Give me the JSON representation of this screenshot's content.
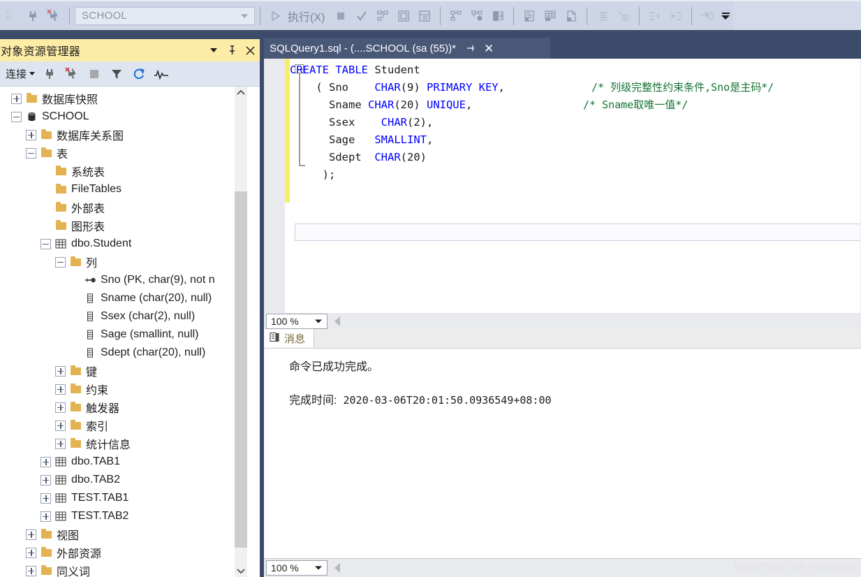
{
  "toolbar": {
    "icons_left": [
      "dotted-grid-icon",
      "connect-plug-icon",
      "disconnect-plug-icon"
    ],
    "database_combo": {
      "value": "SCHOOL",
      "placeholder": "SCHOOL"
    },
    "run_label": "执行(X)",
    "icons_right": [
      "play-icon",
      "stop-icon",
      "parse-check-icon",
      "display-estimated-plan-icon",
      "query-options-icon",
      "include-actual-plan-icon",
      "include-client-statistics-icon",
      "results-to-text-icon",
      "results-to-grid-icon",
      "results-to-file-icon",
      "comment-icon",
      "uncomment-icon",
      "decrease-indent-icon",
      "increase-indent-icon",
      "specify-values-icon"
    ],
    "overflow_label": "toolbar-overflow"
  },
  "object_explorer": {
    "title": "对象资源管理器",
    "title_buttons": [
      "window-menu-icon",
      "pin-icon",
      "close-icon"
    ],
    "toolbar": {
      "connect_label": "连接",
      "icons": [
        "connect-icon",
        "disconnect-icon",
        "stop-icon",
        "filter-icon",
        "refresh-icon",
        "activity-monitor-icon"
      ]
    },
    "tree": [
      {
        "label": "数据库快照",
        "indent": 1,
        "expander": "plus",
        "icon": "folder-icon"
      },
      {
        "label": "SCHOOL",
        "indent": 1,
        "expander": "minus",
        "icon": "database-icon"
      },
      {
        "label": "数据库关系图",
        "indent": 2,
        "expander": "plus",
        "icon": "folder-icon"
      },
      {
        "label": "表",
        "indent": 2,
        "expander": "minus",
        "icon": "folder-icon"
      },
      {
        "label": "系统表",
        "indent": 3,
        "expander": "none",
        "icon": "folder-icon"
      },
      {
        "label": "FileTables",
        "indent": 3,
        "expander": "none",
        "icon": "folder-icon"
      },
      {
        "label": "外部表",
        "indent": 3,
        "expander": "none",
        "icon": "folder-icon"
      },
      {
        "label": "图形表",
        "indent": 3,
        "expander": "none",
        "icon": "folder-icon"
      },
      {
        "label": "dbo.Student",
        "indent": 3,
        "expander": "minus",
        "icon": "table-icon"
      },
      {
        "label": "列",
        "indent": 4,
        "expander": "minus",
        "icon": "folder-icon"
      },
      {
        "label": "Sno (PK, char(9), not n",
        "indent": 5,
        "expander": "none",
        "icon": "primary-key-icon"
      },
      {
        "label": "Sname (char(20), null)",
        "indent": 5,
        "expander": "none",
        "icon": "column-icon"
      },
      {
        "label": "Ssex (char(2), null)",
        "indent": 5,
        "expander": "none",
        "icon": "column-icon"
      },
      {
        "label": "Sage (smallint, null)",
        "indent": 5,
        "expander": "none",
        "icon": "column-icon"
      },
      {
        "label": "Sdept (char(20), null)",
        "indent": 5,
        "expander": "none",
        "icon": "column-icon"
      },
      {
        "label": "键",
        "indent": 4,
        "expander": "plus",
        "icon": "folder-icon"
      },
      {
        "label": "约束",
        "indent": 4,
        "expander": "plus",
        "icon": "folder-icon"
      },
      {
        "label": "触发器",
        "indent": 4,
        "expander": "plus",
        "icon": "folder-icon"
      },
      {
        "label": "索引",
        "indent": 4,
        "expander": "plus",
        "icon": "folder-icon"
      },
      {
        "label": "统计信息",
        "indent": 4,
        "expander": "plus",
        "icon": "folder-icon"
      },
      {
        "label": "dbo.TAB1",
        "indent": 3,
        "expander": "plus",
        "icon": "table-icon"
      },
      {
        "label": "dbo.TAB2",
        "indent": 3,
        "expander": "plus",
        "icon": "table-icon"
      },
      {
        "label": "TEST.TAB1",
        "indent": 3,
        "expander": "plus",
        "icon": "table-icon"
      },
      {
        "label": "TEST.TAB2",
        "indent": 3,
        "expander": "plus",
        "icon": "table-icon"
      },
      {
        "label": "视图",
        "indent": 2,
        "expander": "plus",
        "icon": "folder-icon"
      },
      {
        "label": "外部资源",
        "indent": 2,
        "expander": "plus",
        "icon": "folder-icon"
      },
      {
        "label": "同义词",
        "indent": 2,
        "expander": "plus",
        "icon": "folder-icon"
      }
    ]
  },
  "editor": {
    "tab": {
      "label": "SQLQuery1.sql - (....SCHOOL (sa (55))*",
      "pin_icon": "pin-icon",
      "close_icon": "close-icon"
    },
    "code_lines": [
      [
        {
          "t": "CREATE TABLE ",
          "c": "kw"
        },
        {
          "t": "Student",
          "c": "txt"
        }
      ],
      [
        {
          "t": "    ( Sno    ",
          "c": "txt"
        },
        {
          "t": "CHAR",
          "c": "kw"
        },
        {
          "t": "(9)",
          "c": "txt"
        },
        {
          "t": " PRIMARY KEY",
          "c": "kw"
        },
        {
          "t": ",",
          "c": "txt"
        }
      ],
      [
        {
          "t": "      Sname ",
          "c": "txt"
        },
        {
          "t": "CHAR",
          "c": "kw"
        },
        {
          "t": "(20) ",
          "c": "txt"
        },
        {
          "t": "UNIQUE",
          "c": "kw"
        },
        {
          "t": ",",
          "c": "txt"
        }
      ],
      [
        {
          "t": "      Ssex    ",
          "c": "txt"
        },
        {
          "t": "CHAR",
          "c": "kw"
        },
        {
          "t": "(2),",
          "c": "txt"
        }
      ],
      [
        {
          "t": "      Sage   ",
          "c": "txt"
        },
        {
          "t": "SMALLINT",
          "c": "kw"
        },
        {
          "t": ",",
          "c": "txt"
        }
      ],
      [
        {
          "t": "      Sdept  ",
          "c": "txt"
        },
        {
          "t": "CHAR",
          "c": "kw"
        },
        {
          "t": "(20)",
          "c": "txt"
        }
      ],
      [
        {
          "t": "     );",
          "c": "txt"
        }
      ]
    ],
    "comments": [
      {
        "text": "/* 列级完整性约束条件,Sno是主码*/",
        "line": 1
      },
      {
        "text": "/* Sname取唯一值*/",
        "line": 2
      }
    ],
    "zoom": "100 %"
  },
  "results": {
    "tab_label": "消息",
    "tab_icon": "messages-icon",
    "line1": "命令已成功完成。",
    "completion_label": "完成时间:",
    "completion_time": "2020-03-06T20:01:50.0936549+08:00",
    "zoom": "100 %"
  },
  "watermark": "https://blog.csdn.net/sjkylzy",
  "colors": {
    "toolbar_bg": "#cdd5e6",
    "chrome_dark": "#3d4b6b",
    "oe_title_bg": "#fdeca6",
    "tab_active_bg": "#4a5878",
    "keyword_blue": "#0000ff",
    "comment_green": "#137333",
    "change_bar_yellow": "#f6f069",
    "folder_gold": "#e3b251"
  }
}
